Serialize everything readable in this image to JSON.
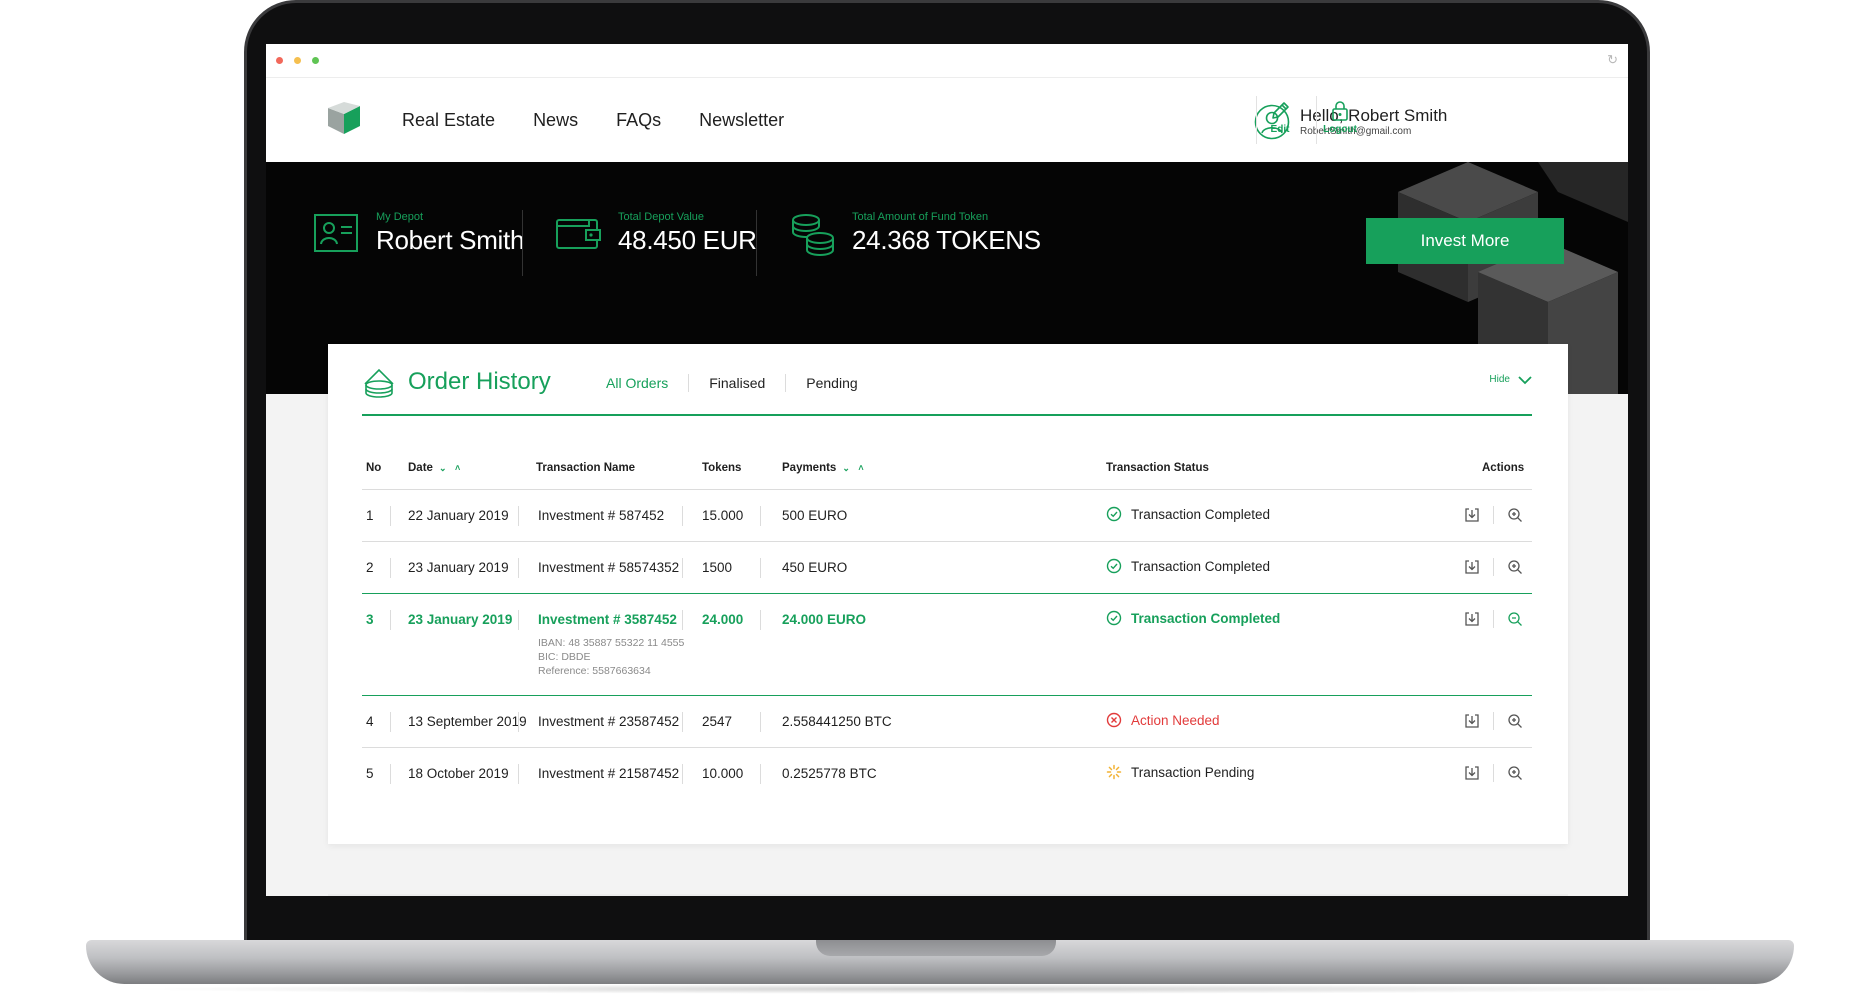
{
  "nav": {
    "links": [
      "Real Estate",
      "News",
      "FAQs",
      "Newsletter"
    ],
    "user": {
      "greeting": "Hello, Robert Smith",
      "email": "RobertSmith@gmail.com"
    },
    "edit_label": "Edit",
    "logout_label": "Logout"
  },
  "banner": {
    "depot": {
      "label": "My Depot",
      "value": "Robert Smith"
    },
    "depot_value": {
      "label": "Total Depot Value",
      "value": "48.450 EUR"
    },
    "fund_token": {
      "label": "Total Amount of Fund Token",
      "value": "24.368 TOKENS"
    },
    "invest_label": "Invest More"
  },
  "orders": {
    "title": "Order History",
    "tabs": [
      "All Orders",
      "Finalised",
      "Pending"
    ],
    "hide_label": "Hide",
    "headers": {
      "no": "No",
      "date": "Date",
      "name": "Transaction Name",
      "tokens": "Tokens",
      "payments": "Payments",
      "status": "Transaction Status",
      "actions": "Actions"
    },
    "rows": [
      {
        "no": "1",
        "date": "22 January 2019",
        "name": "Investment # 587452",
        "tokens": "15.000",
        "payment": "500 EURO",
        "status": "Transaction Completed",
        "state": "ok"
      },
      {
        "no": "2",
        "date": "23 January 2019",
        "name": "Investment # 58574352",
        "tokens": "1500",
        "payment": "450 EURO",
        "status": "Transaction Completed",
        "state": "ok"
      },
      {
        "no": "3",
        "date": "23 January 2019",
        "name": "Investment # 3587452",
        "tokens": "24.000",
        "payment": "24.000 EURO",
        "status": "Transaction Completed",
        "state": "ok",
        "iban": "IBAN: 48 35887 55322 11 4555",
        "bic": "BIC: DBDE",
        "reference": "Reference: 5587663634"
      },
      {
        "no": "4",
        "date": "13 September 2019",
        "name": "Investment # 23587452",
        "tokens": "2547",
        "payment": "2.558441250 BTC",
        "status": "Action Needed",
        "state": "error"
      },
      {
        "no": "5",
        "date": "18 October 2019",
        "name": "Investment # 21587452",
        "tokens": "10.000",
        "payment": "0.2525778 BTC",
        "status": "Transaction Pending",
        "state": "pending"
      }
    ]
  },
  "colors": {
    "accent": "#17a05b",
    "error": "#e23b3b",
    "pending": "#f2b233",
    "banner": "#050505"
  }
}
